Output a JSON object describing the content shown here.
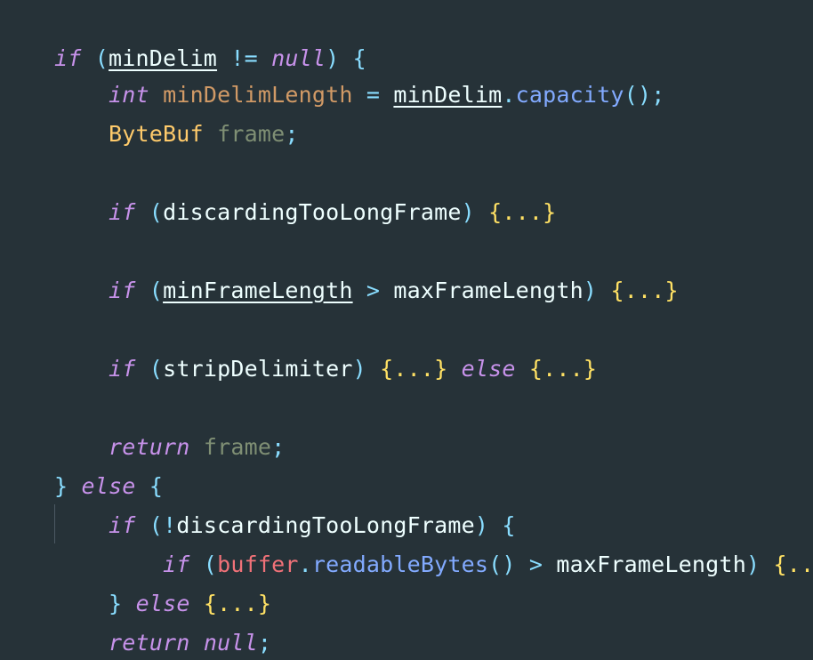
{
  "code": {
    "lines": [
      [
        "if",
        " (",
        "minDelim",
        " != ",
        "null",
        ") ",
        "{"
      ],
      [
        "    ",
        "int",
        " ",
        "minDelimLength",
        " ",
        "=",
        " ",
        "minDelim",
        ".",
        "capacity",
        "();"
      ],
      [
        "    ",
        "ByteBuf",
        " ",
        "frame",
        ";"
      ],
      [
        ""
      ],
      [
        "    ",
        "if",
        " (",
        "discardingTooLongFrame",
        ") ",
        "{...}"
      ],
      [
        ""
      ],
      [
        "    ",
        "if",
        " (",
        "minFrameLength",
        " ",
        ">",
        " ",
        "maxFrameLength",
        ") ",
        "{...}"
      ],
      [
        ""
      ],
      [
        "    ",
        "if",
        " (",
        "stripDelimiter",
        ") ",
        "{...}",
        " ",
        "else",
        " ",
        "{...}"
      ],
      [
        ""
      ],
      [
        "    ",
        "return",
        " ",
        "frame",
        ";"
      ],
      [
        "}",
        " ",
        "else",
        " ",
        "{"
      ],
      [
        "    ",
        "if",
        " (",
        "!",
        "discardingTooLongFrame",
        ") ",
        "{"
      ],
      [
        "        ",
        "if",
        " (",
        "buffer",
        ".",
        "readableBytes",
        "() ",
        ">",
        " ",
        "maxFrameLength",
        ") ",
        "{...}"
      ],
      [
        "    ",
        "}",
        " ",
        "else",
        " ",
        "{...}"
      ],
      [
        "    ",
        "return",
        " ",
        "null",
        ";"
      ],
      [
        "}"
      ]
    ]
  }
}
